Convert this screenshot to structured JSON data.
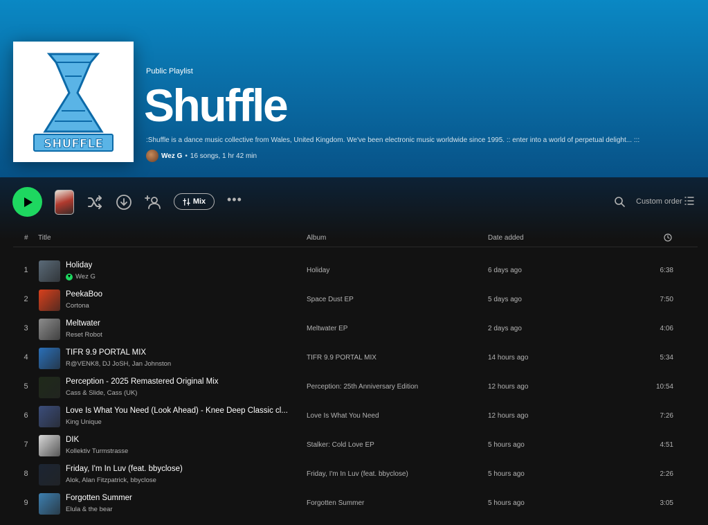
{
  "playlist": {
    "kicker": "Public Playlist",
    "title": "Shuffle",
    "description": ":Shuffle is a dance music collective from Wales, United Kingdom. We've been electronic music worldwide since 1995. :: enter into a world of perpetual delight... :::",
    "owner": "Wez G",
    "separator": "•",
    "stats": "16 songs, 1 hr 42 min",
    "cover_text": "SHUFFLE"
  },
  "actions": {
    "mix_label": "Mix",
    "more_label": "•••",
    "sort_label": "Custom order"
  },
  "table": {
    "headers": {
      "num": "#",
      "title": "Title",
      "album": "Album",
      "date": "Date added"
    },
    "rows": [
      {
        "num": "1",
        "title": "Holiday",
        "artist": "Wez G",
        "album": "Holiday",
        "date": "6 days ago",
        "duration": "6:38",
        "downloaded": true,
        "thumb": "#5a6a78"
      },
      {
        "num": "2",
        "title": "PeekaBoo",
        "artist": "Cortona",
        "album": "Space Dust EP",
        "date": "5 days ago",
        "duration": "7:50",
        "downloaded": false,
        "thumb": "#d9401c"
      },
      {
        "num": "3",
        "title": "Meltwater",
        "artist": "Reset Robot",
        "album": "Meltwater EP",
        "date": "2 days ago",
        "duration": "4:06",
        "downloaded": false,
        "thumb": "#8c8c8c"
      },
      {
        "num": "4",
        "title": "TIFR 9.9 PORTAL MIX",
        "artist": "R@VENK8, DJ JoSH, Jan Johnston",
        "album": "TIFR 9.9 PORTAL MIX",
        "date": "14 hours ago",
        "duration": "5:34",
        "downloaded": false,
        "thumb": "#2a6fb8"
      },
      {
        "num": "5",
        "title": "Perception - 2025 Remastered Original Mix",
        "artist": "Cass & Slide, Cass (UK)",
        "album": "Perception: 25th Anniversary Edition",
        "date": "12 hours ago",
        "duration": "10:54",
        "downloaded": false,
        "thumb": "#1f2a1a"
      },
      {
        "num": "6",
        "title": "Love Is What You Need (Look Ahead) - Knee Deep Classic cl...",
        "artist": "King Unique",
        "album": "Love Is What You Need",
        "date": "12 hours ago",
        "duration": "7:26",
        "downloaded": false,
        "thumb": "#3b4d7a"
      },
      {
        "num": "7",
        "title": "DIK",
        "artist": "Kollektiv Turmstrasse",
        "album": "Stalker: Cold Love EP",
        "date": "5 hours ago",
        "duration": "4:51",
        "downloaded": false,
        "thumb": "#d8d8d8"
      },
      {
        "num": "8",
        "title": "Friday, I'm In Luv (feat. bbyclose)",
        "artist": "Alok, Alan Fitzpatrick, bbyclose",
        "album": "Friday, I'm In Luv (feat. bbyclose)",
        "date": "5 hours ago",
        "duration": "2:26",
        "downloaded": false,
        "thumb": "#1c2533"
      },
      {
        "num": "9",
        "title": "Forgotten Summer",
        "artist": "Elula & the bear",
        "album": "Forgotten Summer",
        "date": "5 hours ago",
        "duration": "3:05",
        "downloaded": false,
        "thumb": "#3d7fb0"
      }
    ]
  },
  "colors": {
    "accent": "#1ed760",
    "hero_top": "#0a88c4",
    "background": "#121212"
  }
}
